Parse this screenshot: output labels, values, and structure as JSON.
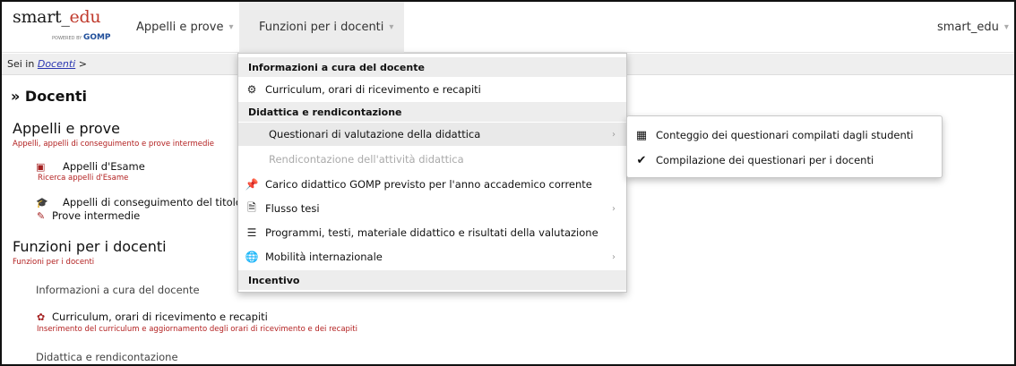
{
  "navbar": {
    "brand_main": "smart",
    "brand_edu": "edu",
    "brand_powered": "POWERED BY",
    "brand_gomp": "GOMP",
    "appelli_label": "Appelli e prove",
    "funzioni_label": "Funzioni per i docenti",
    "user_label": "smart_edu",
    "caret": "⌄"
  },
  "breadcrumb": {
    "prefix": "Sei in",
    "link": "Docenti",
    "sep": ">"
  },
  "main": {
    "page_title": "» Docenti",
    "appelli": {
      "title": "Appelli e prove",
      "subtitle": "Appelli, appelli di conseguimento e prove intermedie",
      "items": [
        {
          "label": "Appelli d'Esame",
          "sub": "Ricerca appelli d'Esame"
        },
        {
          "label": "Appelli di conseguimento del titolo"
        },
        {
          "label": "Prove intermedie"
        }
      ]
    },
    "funzioni": {
      "title": "Funzioni per i docenti",
      "subtitle": "Funzioni per i docenti",
      "group1": "Informazioni a cura del docente",
      "curriculum_label": "Curriculum, orari di ricevimento e recapiti",
      "curriculum_sub": "Inserimento del curriculum e aggiornamento degli orari di ricevimento e dei recapiti",
      "group2": "Didattica e rendicontazione"
    }
  },
  "dropdown": {
    "header_info": "Informazioni a cura del docente",
    "curriculum": "Curriculum, orari di ricevimento e recapiti",
    "header_didattica": "Didattica e rendicontazione",
    "questionari": "Questionari di valutazione della didattica",
    "rendicontazione": "Rendicontazione dell'attività didattica",
    "carico": "Carico didattico GOMP previsto per l'anno accademico corrente",
    "flusso": "Flusso tesi",
    "programmi": "Programmi, testi, materiale didattico e risultati della valutazione",
    "mobilita": "Mobilità internazionale",
    "header_incentivo": "Incentivo"
  },
  "submenu": {
    "conteggio": "Conteggio dei questionari compilati dagli studenti",
    "compilazione": "Compilazione dei questionari per i docenti"
  },
  "colors": {
    "accent_red": "#b21f1f",
    "link_blue": "#2a36b1",
    "menu_header_bg": "#ededed"
  }
}
